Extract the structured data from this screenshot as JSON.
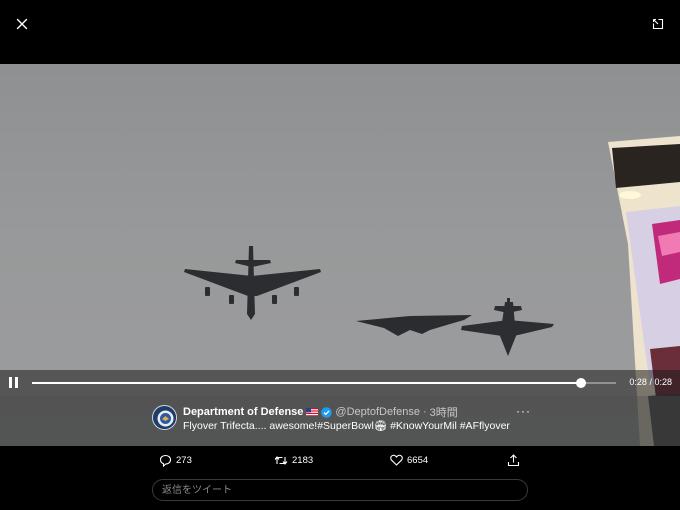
{
  "icons": {
    "close": "close-icon",
    "expand": "expand-icon",
    "pause": "pause-icon",
    "more": "more-icon",
    "reply": "reply-icon",
    "retweet": "retweet-icon",
    "like": "heart-icon",
    "share": "share-icon",
    "verified": "verified-badge-icon",
    "flag": "us-flag-emoji"
  },
  "colors": {
    "background": "#000000",
    "accent": "#1d9bf0",
    "sky": "#999a9b"
  },
  "video": {
    "current_time": "0:28",
    "separator": "/",
    "duration": "0:28",
    "progress_fraction": 0.94
  },
  "tweet": {
    "display_name": "Department of Defense",
    "handle": "@DeptofDefense",
    "separator": "·",
    "time_ago": "3時間",
    "text": "Flyover Trifecta.... awesome!#SuperBowl🏟 #KnowYourMil #AFflyover",
    "more_label": "···"
  },
  "actions": {
    "replies": "273",
    "retweets": "2183",
    "likes": "6654"
  },
  "reply": {
    "placeholder": "返信をツイート"
  }
}
